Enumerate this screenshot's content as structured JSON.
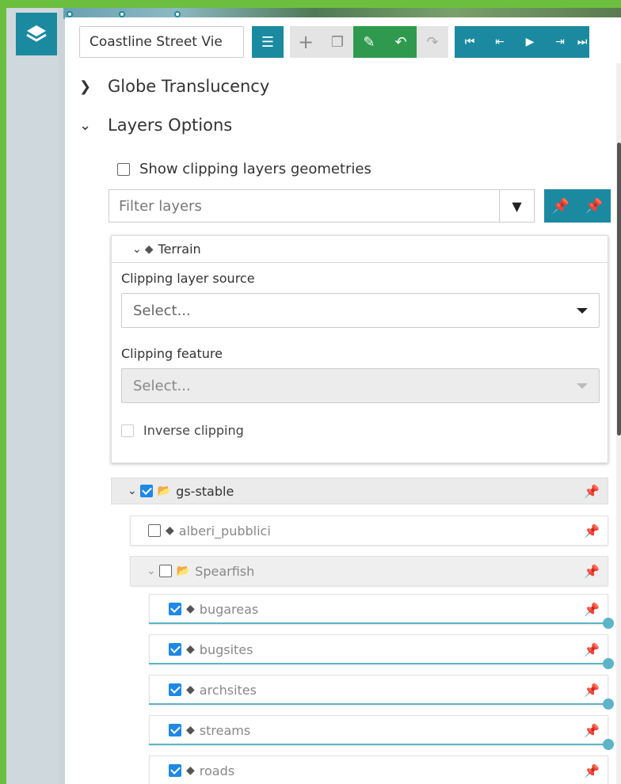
{
  "toolbar": {
    "title_value": "Coastline Street Vie",
    "buttons": [
      {
        "name": "list-icon",
        "glyph": "☰"
      },
      {
        "name": "plus-icon",
        "glyph": "+"
      },
      {
        "name": "copy-icon",
        "glyph": "❐"
      },
      {
        "name": "edit-icon",
        "glyph": "✎"
      },
      {
        "name": "undo-icon",
        "glyph": "↶"
      },
      {
        "name": "redo-icon",
        "glyph": "↷"
      },
      {
        "name": "first-icon",
        "glyph": "⏮"
      },
      {
        "name": "prev-icon",
        "glyph": "⇤"
      },
      {
        "name": "play-icon",
        "glyph": "▶"
      },
      {
        "name": "next-icon",
        "glyph": "⇥"
      },
      {
        "name": "last-icon",
        "glyph": "⏭"
      }
    ]
  },
  "accordion": {
    "globe_translucency": "Globe Translucency",
    "layers_options": "Layers Options"
  },
  "options": {
    "show_clipping_label": "Show clipping layers geometries"
  },
  "filter": {
    "placeholder": "Filter layers"
  },
  "terrain": {
    "title": "Terrain",
    "clipping_source_label": "Clipping layer source",
    "clipping_source_value": "Select...",
    "clipping_feature_label": "Clipping feature",
    "clipping_feature_value": "Select...",
    "inverse_label": "Inverse clipping"
  },
  "groups": {
    "gs_stable": "gs-stable",
    "alberi": "alberi_pubblici",
    "spearfish": "Spearfish"
  },
  "layers": [
    {
      "label": "bugareas",
      "checked": true
    },
    {
      "label": "bugsites",
      "checked": true
    },
    {
      "label": "archsites",
      "checked": true
    },
    {
      "label": "streams",
      "checked": true
    },
    {
      "label": "roads",
      "checked": true
    }
  ],
  "colors": {
    "accent": "#1b8aa0",
    "edit_green": "#2f9a4e",
    "frame_green": "#6bbf3f",
    "slider": "#5bb4c8"
  }
}
